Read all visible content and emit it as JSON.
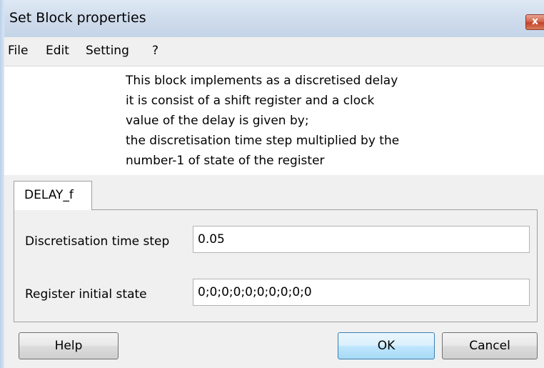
{
  "window": {
    "title": "Set Block properties",
    "close_glyph": "x"
  },
  "menu": {
    "items": [
      {
        "label": "File"
      },
      {
        "label": "Edit"
      },
      {
        "label": "Setting"
      },
      {
        "label": "?"
      }
    ]
  },
  "description": {
    "lines": [
      "This block implements as a discretised delay",
      "it is consist of a shift register and a clock",
      "value of the delay is given by;",
      "the discretisation time step multiplied by the",
      "number-1 of state of the register"
    ]
  },
  "tabs": [
    {
      "label": "DELAY_f",
      "selected": true
    }
  ],
  "form": {
    "time_step": {
      "label": "Discretisation time step",
      "value": "0.05"
    },
    "initial_state": {
      "label": "Register initial state",
      "value": "0;0;0;0;0;0;0;0;0;0"
    }
  },
  "buttons": {
    "help": "Help",
    "ok": "OK",
    "cancel": "Cancel"
  },
  "colors": {
    "titlebar": "#cfdcec",
    "close_button": "#c2432b",
    "default_button_border": "#3c7fb1",
    "background": "#f0f0f0"
  }
}
